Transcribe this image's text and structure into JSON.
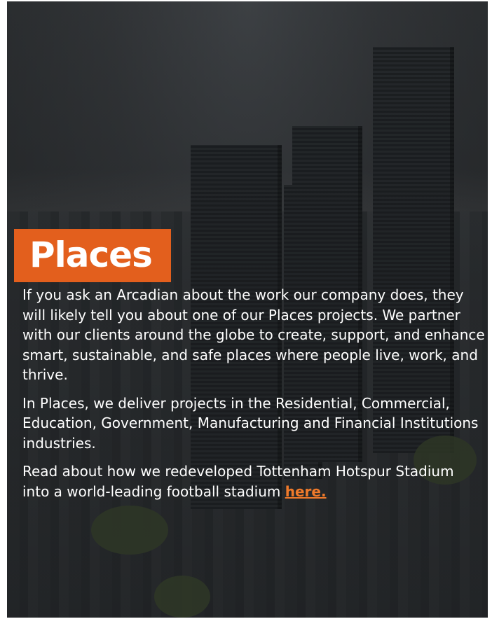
{
  "section": {
    "title": "Places",
    "paragraphs": [
      "If you ask an Arcadian about the work our company does, they will likely tell you about one of our Places projects. We partner with our clients around the globe to create, support, and enhance smart, sustainable, and safe places where people live, work, and thrive.",
      "In Places, we deliver projects in the Residential, Commercial, Education, Government, Manufacturing and Financial Institutions industries."
    ],
    "read_more_prefix": "Read about how we redeveloped Tottenham Hotspur Stadium into a world-leading football stadium ",
    "read_more_link": "here."
  },
  "colors": {
    "accent": "#e35f1d",
    "link": "#f07a2a",
    "text": "#ffffff"
  }
}
